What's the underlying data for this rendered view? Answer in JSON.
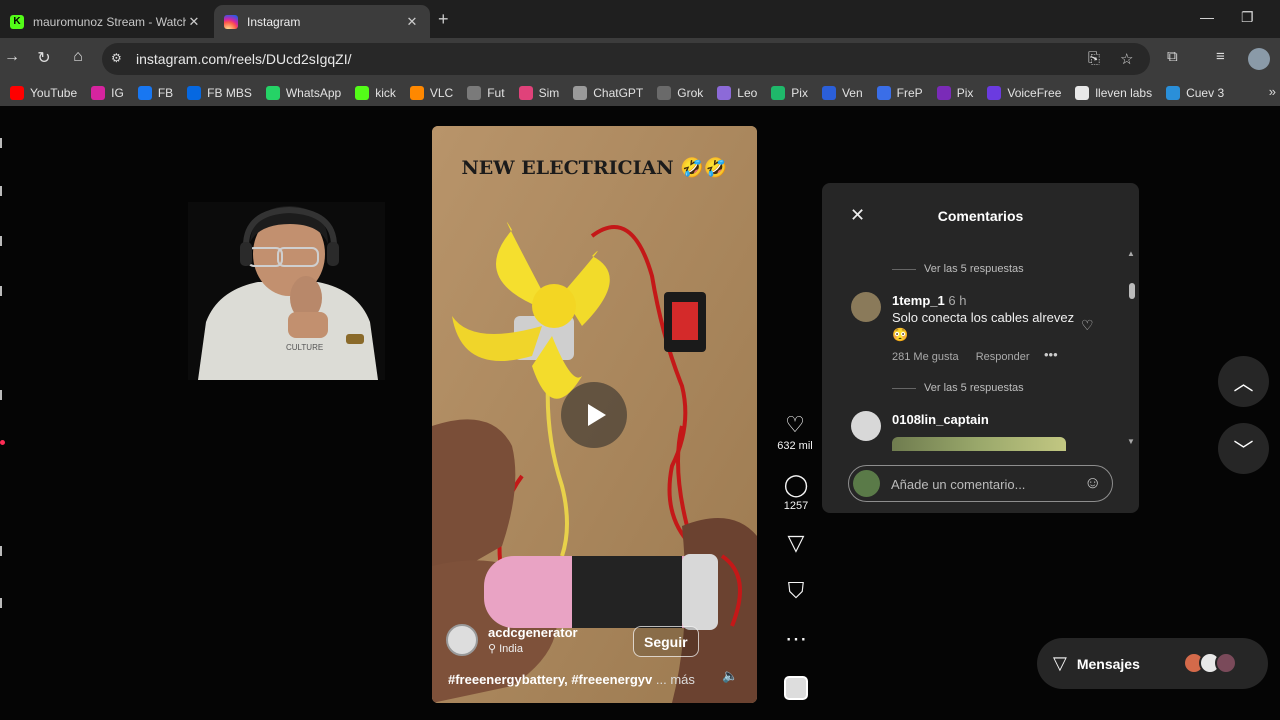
{
  "browser": {
    "tabs": [
      {
        "title": "mauromunoz Stream - Watch Li",
        "active": false
      },
      {
        "title": "Instagram",
        "active": true
      }
    ],
    "new_tab_icon": "plus-icon",
    "url": "instagram.com/reels/DUcd2sIgqZI/",
    "bookmarks": [
      {
        "label": "YouTube",
        "color": "#ff0000"
      },
      {
        "label": "IG",
        "color": "#d6249f"
      },
      {
        "label": "FB",
        "color": "#1877f2"
      },
      {
        "label": "FB MBS",
        "color": "#0668e1"
      },
      {
        "label": "WhatsApp",
        "color": "#25d366"
      },
      {
        "label": "kick",
        "color": "#53fc18"
      },
      {
        "label": "VLC",
        "color": "#ff8800"
      },
      {
        "label": "Fut",
        "color": "#7a7a7a"
      },
      {
        "label": "Sim",
        "color": "#e0427a"
      },
      {
        "label": "ChatGPT",
        "color": "#9a9a9a"
      },
      {
        "label": "Grok",
        "color": "#6a6a6a"
      },
      {
        "label": "Leo",
        "color": "#8c6ad8"
      },
      {
        "label": "Pix",
        "color": "#1fb86a"
      },
      {
        "label": "Ven",
        "color": "#2b5fd9"
      },
      {
        "label": "FreP",
        "color": "#3a6ee8"
      },
      {
        "label": "Pix",
        "color": "#7a2bb8"
      },
      {
        "label": "VoiceFree",
        "color": "#6b3be0"
      },
      {
        "label": "lleven labs",
        "color": "#e8e8e8"
      },
      {
        "label": "Cuev 3",
        "color": "#2a8fd9"
      }
    ]
  },
  "reel": {
    "overlay_title": "NEW ELECTRICIAN 🤣🤣",
    "author": "acdcgenerator",
    "location": "India",
    "follow_label": "Seguir",
    "caption": "#freeenergybattery, #freeenergyv",
    "caption_more": "... más",
    "actions": {
      "likes": "632 mil",
      "comments": "1257"
    }
  },
  "comments_panel": {
    "title": "Comentarios",
    "view_replies": "Ver las 5 respuestas",
    "comments": [
      {
        "user": "1temp_1",
        "time": "6 h",
        "text": "Solo conecta los cables alrevez 😳",
        "likes": "281 Me gusta",
        "reply": "Responder"
      },
      {
        "user": "0108lin_captain"
      }
    ],
    "input_placeholder": "Añade un comentario..."
  },
  "messages": {
    "label": "Mensajes"
  }
}
